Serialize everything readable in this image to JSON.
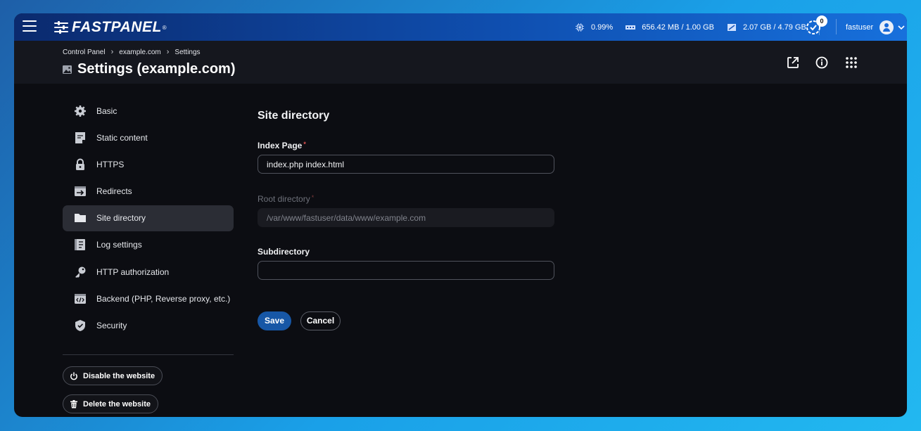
{
  "topbar": {
    "logo_text": "FASTPANEL",
    "logo_reg": "®",
    "cpu": "0.99%",
    "ram": "656.42 MB / 1.00 GB",
    "disk": "2.07 GB / 4.79 GB",
    "tasks_count": "0",
    "username": "fastuser"
  },
  "breadcrumb": [
    "Control Panel",
    "example.com",
    "Settings"
  ],
  "page_title": "Settings (example.com)",
  "sidebar": {
    "items": [
      {
        "label": "Basic",
        "icon": "gear-icon"
      },
      {
        "label": "Static content",
        "icon": "document-icon"
      },
      {
        "label": "HTTPS",
        "icon": "lock-icon"
      },
      {
        "label": "Redirects",
        "icon": "redirect-icon"
      },
      {
        "label": "Site directory",
        "icon": "folder-icon",
        "active": true
      },
      {
        "label": "Log settings",
        "icon": "log-icon"
      },
      {
        "label": "HTTP authorization",
        "icon": "key-icon"
      },
      {
        "label": "Backend (PHP, Reverse proxy, etc.)",
        "icon": "code-icon"
      },
      {
        "label": "Security",
        "icon": "shield-icon"
      }
    ],
    "disable_label": "Disable the website",
    "delete_label": "Delete the website"
  },
  "form": {
    "section_title": "Site directory",
    "index_label": "Index Page",
    "index_value": "index.php index.html",
    "root_label": "Root directory",
    "root_value": "/var/www/fastuser/data/www/example.com",
    "subdir_label": "Subdirectory",
    "subdir_value": "",
    "save_label": "Save",
    "cancel_label": "Cancel"
  },
  "colors": {
    "accent": "#1757a6",
    "required": "#e05252"
  }
}
